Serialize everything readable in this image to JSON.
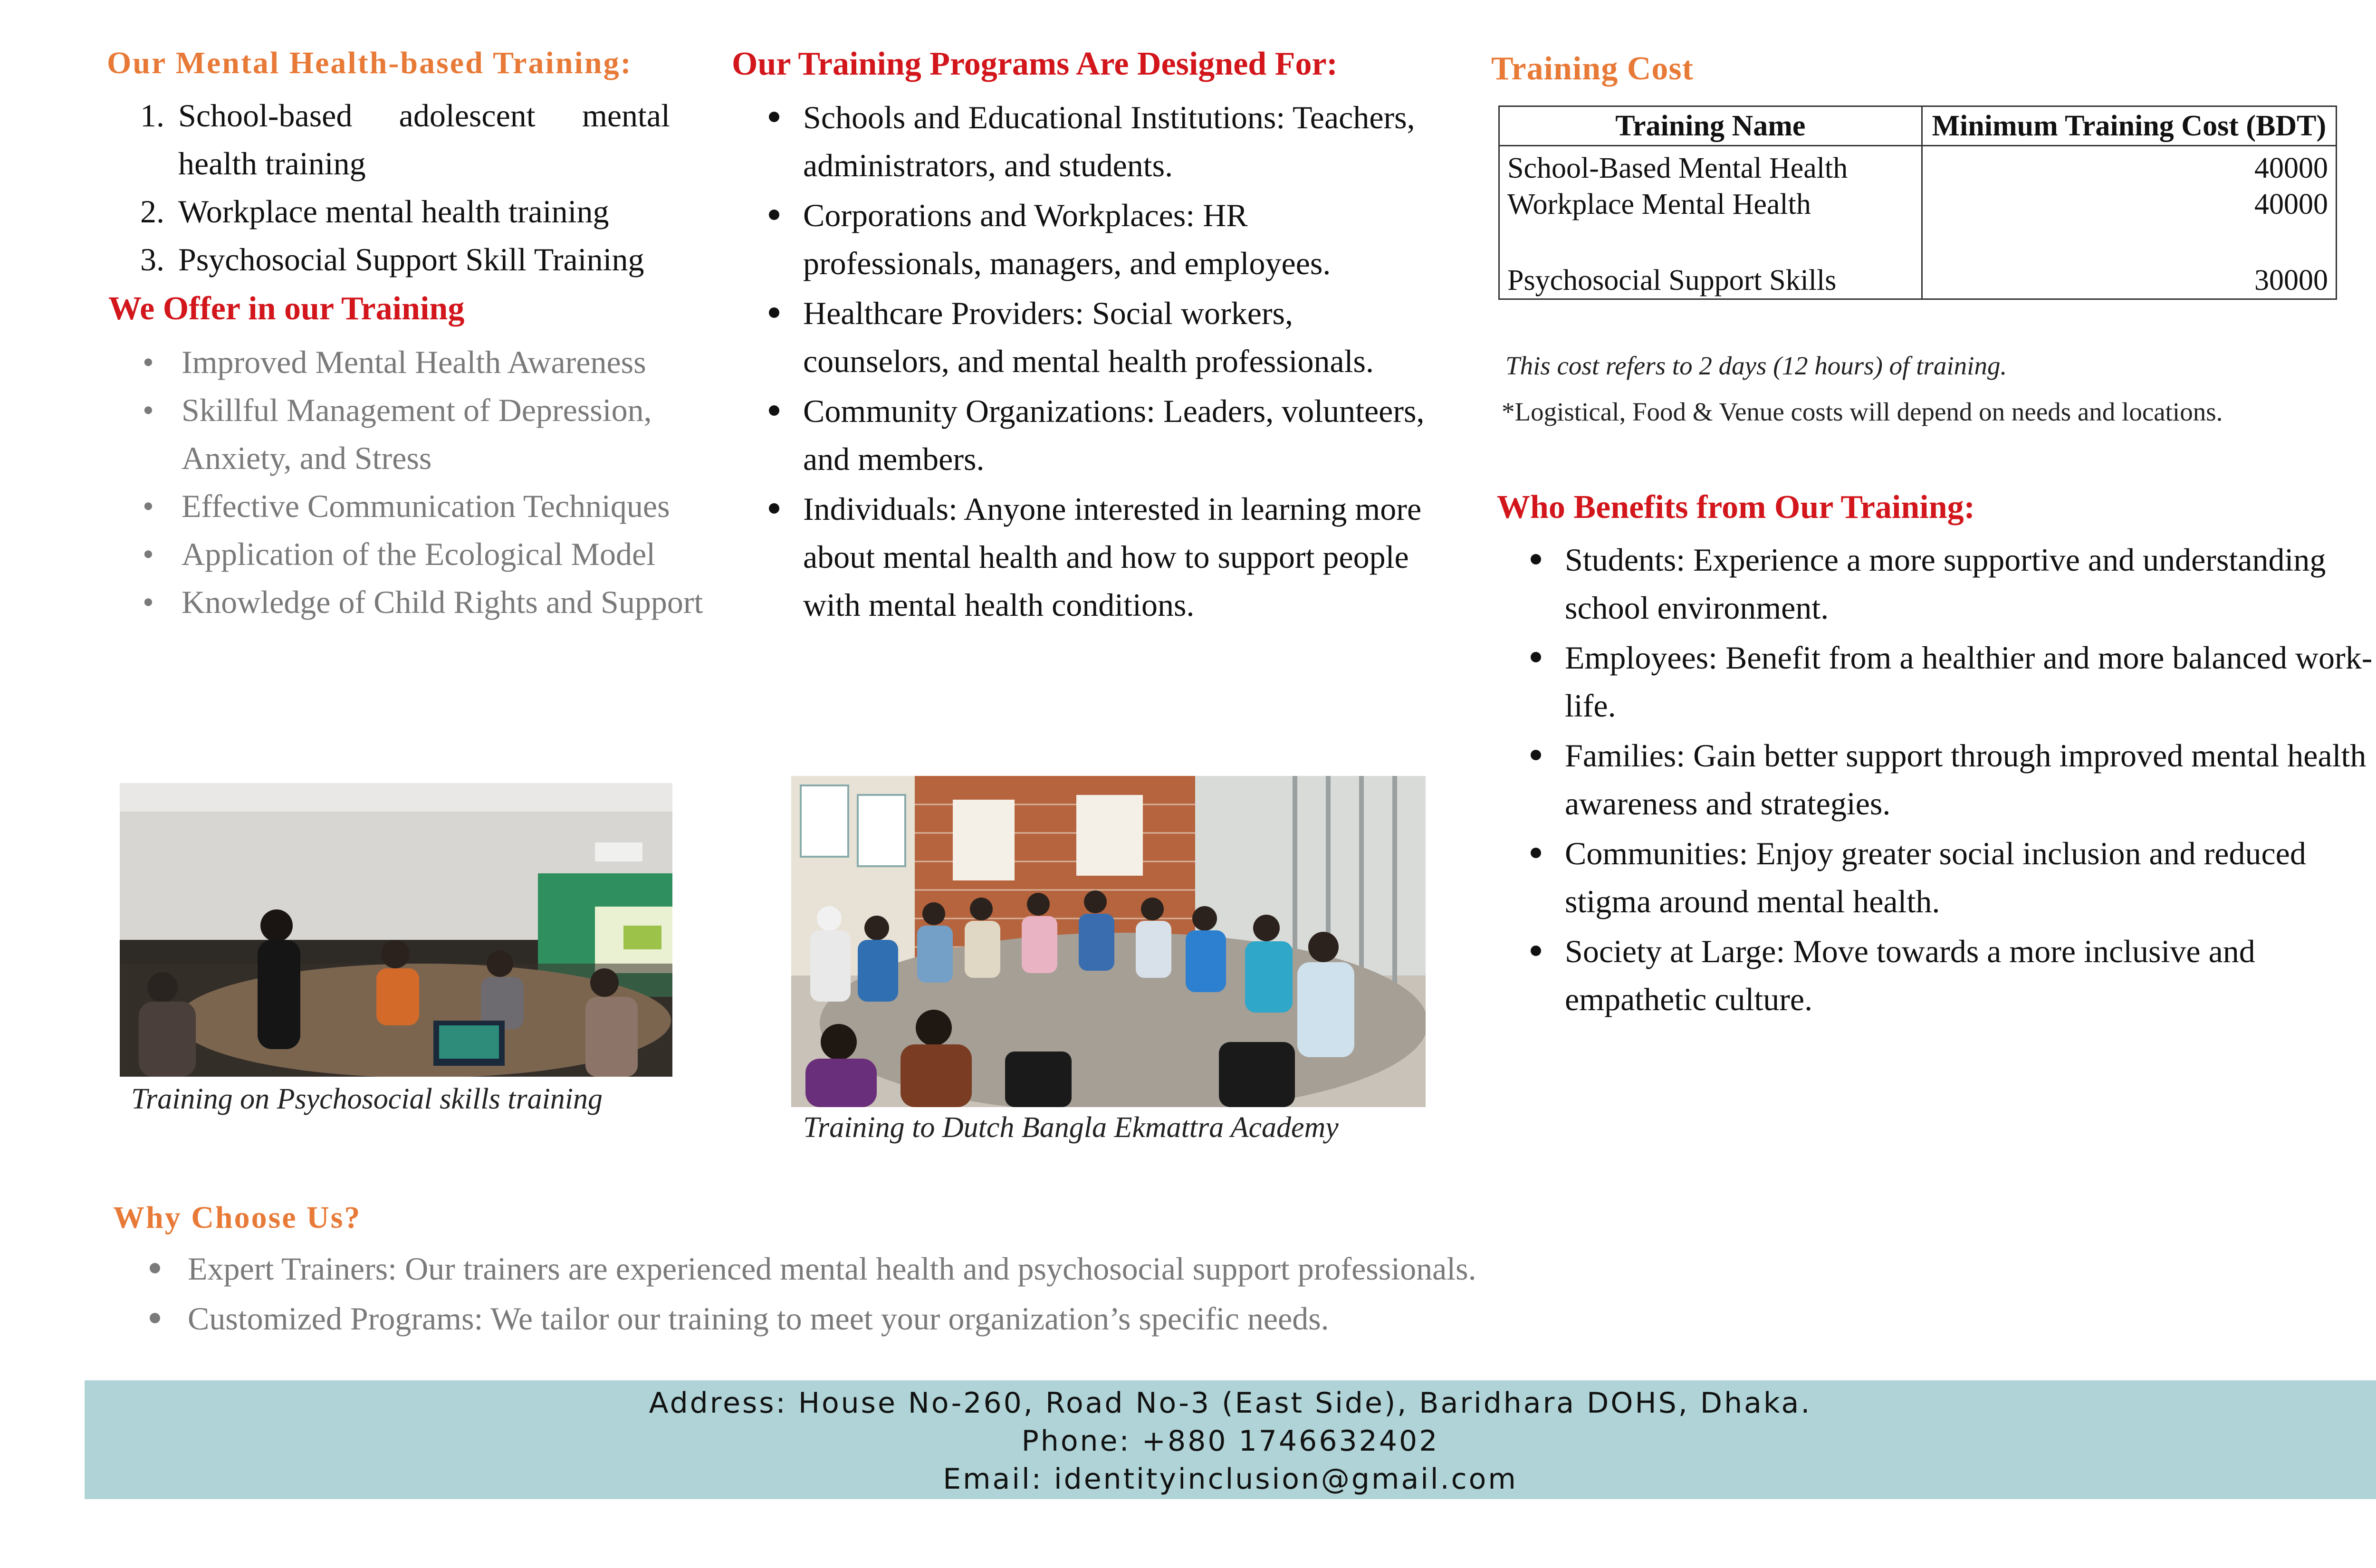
{
  "col1": {
    "heading1": "Our Mental Health-based Training:",
    "numbered": [
      {
        "n": "1.",
        "text": "School-based adolescent mental health training"
      },
      {
        "n": "2.",
        "text": "Workplace mental health training"
      },
      {
        "n": "3.",
        "text": "Psychosocial Support Skill Training"
      }
    ],
    "heading2": "We Offer in our Training",
    "offers": [
      "Improved Mental Health Awareness",
      "Skillful Management of Depression, Anxiety, and Stress",
      "Effective Communication Techniques",
      "Application of the Ecological Model",
      "Knowledge of Child Rights and Support"
    ],
    "caption": "Training on Psychosocial skills training"
  },
  "col2": {
    "heading": "Our Training Programs Are Designed For:",
    "items": [
      "Schools and Educational Institutions: Teachers, administrators, and students.",
      "Corporations and Workplaces: HR professionals, managers, and employees.",
      "Healthcare Providers: Social workers, counselors, and mental health professionals.",
      "Community Organizations: Leaders, volunteers, and members.",
      "Individuals: Anyone interested in learning more about mental health and how to support people with mental health conditions."
    ],
    "caption": "Training to Dutch Bangla Ekmattra Academy"
  },
  "col3": {
    "heading": "Training Cost",
    "table": {
      "headers": [
        "Training Name",
        "Minimum Training Cost (BDT)"
      ],
      "rows": [
        {
          "name": "School-Based Mental Health",
          "cost": "40000"
        },
        {
          "name": "Workplace Mental Health",
          "cost": "40000"
        },
        {
          "name": "Psychosocial Support Skills",
          "cost": "30000"
        }
      ]
    },
    "note1": "This cost refers to 2 days (12 hours) of training.",
    "note2": "*Logistical, Food & Venue costs will depend on needs and locations.",
    "benefits_heading": "Who Benefits from Our Training:",
    "benefits": [
      "Students: Experience a more supportive and understanding school environment.",
      "Employees: Benefit from a healthier and more balanced work-life.",
      "Families: Gain better support through improved mental health awareness and strategies.",
      "Communities: Enjoy greater social inclusion and reduced stigma around mental health.",
      "Society at Large: Move towards a more inclusive and empathetic culture."
    ]
  },
  "why": {
    "heading": "Why Choose Us?",
    "items": [
      "Expert Trainers: Our trainers are experienced mental health and psychosocial support professionals.",
      "Customized Programs: We tailor our training to meet your organization’s specific needs."
    ]
  },
  "footer": {
    "address": "Address: House No-260, Road No-3 (East Side), Baridhara DOHS, Dhaka.",
    "phone": "Phone: +880 1746632402",
    "email": "Email: identityinclusion@gmail.com"
  }
}
